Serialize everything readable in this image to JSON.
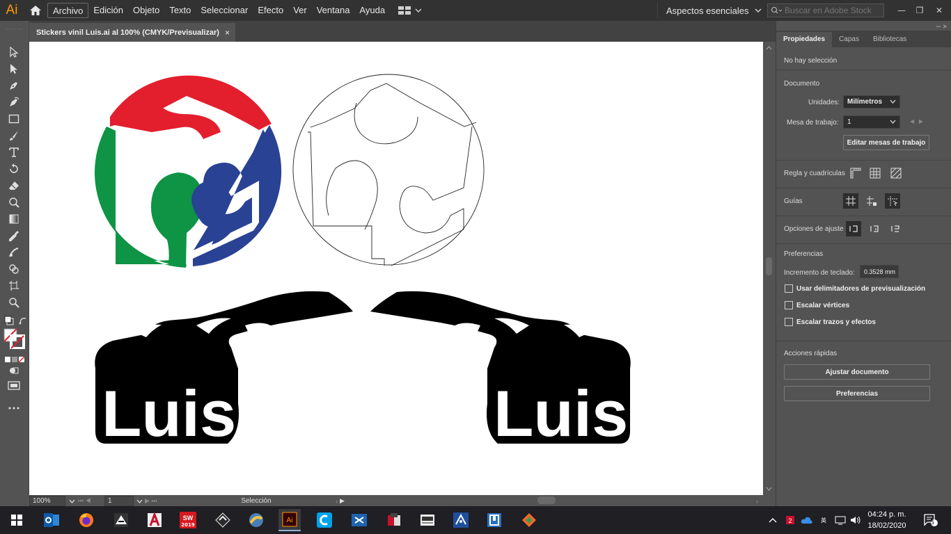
{
  "app": {
    "logo": "Ai",
    "menu": [
      "Archivo",
      "Edición",
      "Objeto",
      "Texto",
      "Seleccionar",
      "Efecto",
      "Ver",
      "Ventana",
      "Ayuda"
    ],
    "workspace": "Aspectos esenciales",
    "stock_placeholder": "Buscar en Adobe Stock",
    "window_controls": [
      "—",
      "❐",
      "✕"
    ]
  },
  "document": {
    "tab_title": "Stickers vinil Luis.ai al 100% (CMYK/Previsualizar)",
    "close": "×",
    "artwork_text": [
      "Luis",
      "Luis"
    ]
  },
  "status": {
    "zoom": "100%",
    "artboard": "1",
    "tool": "Selección"
  },
  "panel": {
    "tabs": [
      "Propiedades",
      "Capas",
      "Bibliotecas"
    ],
    "no_selection": "No hay selección",
    "document_title": "Documento",
    "units_label": "Unidades:",
    "units_value": "Milímetros",
    "artboard_label": "Mesa de trabajo:",
    "artboard_value": "1",
    "edit_artboards": "Editar mesas de trabajo",
    "rulers_label": "Regla y cuadrículas",
    "guides_label": "Guías",
    "snap_label": "Opciones de ajuste",
    "prefs_title": "Preferencias",
    "keyboard_inc_label": "Incremento de teclado:",
    "keyboard_inc_value": "0.3528 mm",
    "checkboxes": [
      "Usar delimitadores de previsualización",
      "Escalar vértices",
      "Escalar trazos y efectos"
    ],
    "quick_actions_title": "Acciones rápidas",
    "fit_document": "Ajustar documento",
    "preferences_btn": "Preferencias"
  },
  "taskbar": {
    "time": "04:24 p. m.",
    "date": "18/02/2020",
    "notifications": "5",
    "sw_label": "2019"
  },
  "colors": {
    "accent_ai": "#ff9a00",
    "red": "#e31e2d",
    "green": "#0e9444",
    "blue": "#2a4294"
  }
}
